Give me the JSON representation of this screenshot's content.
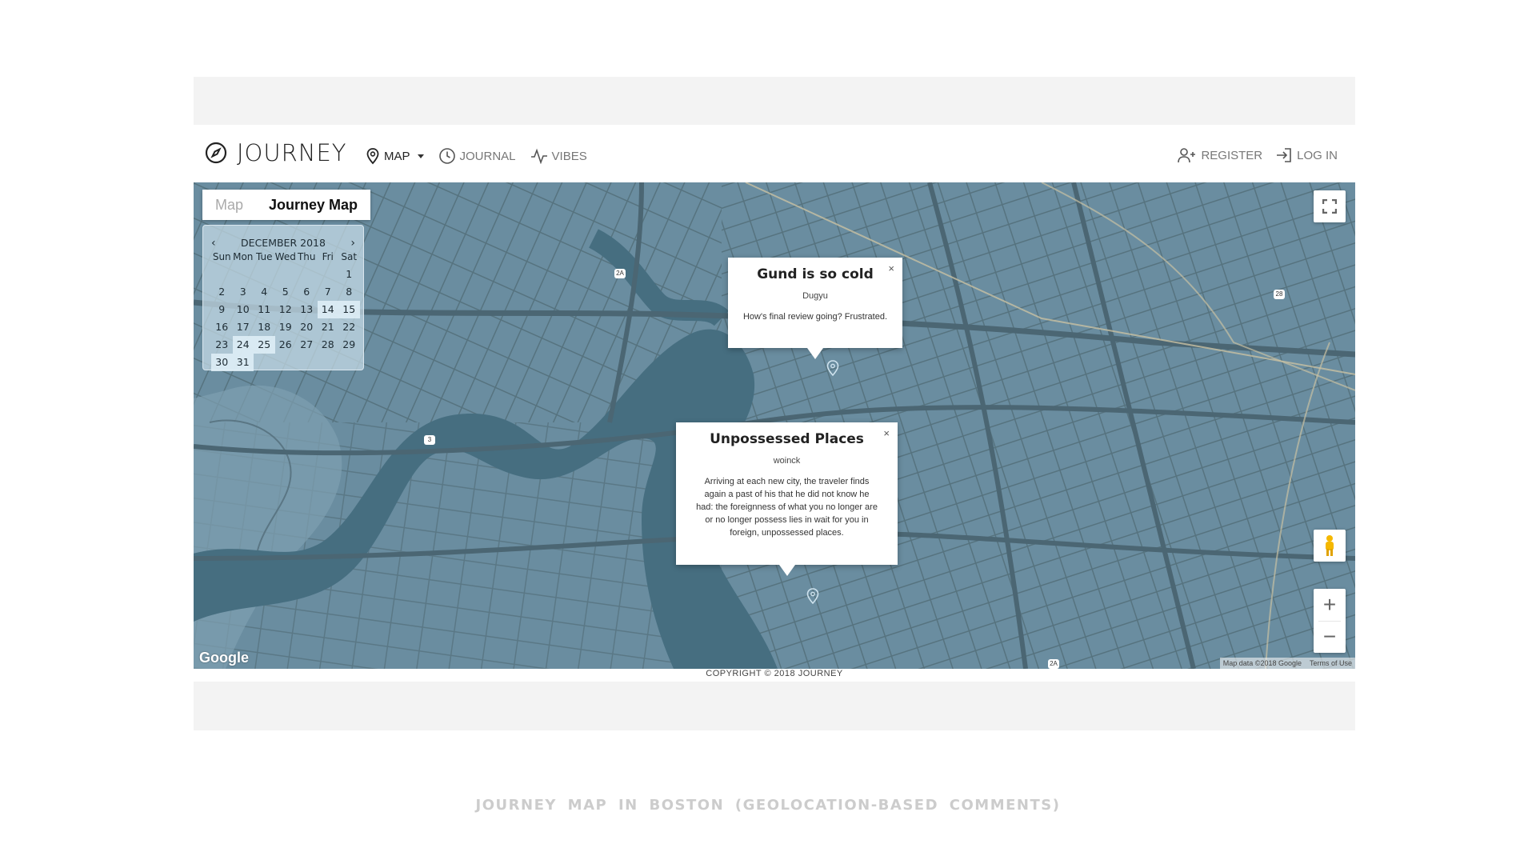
{
  "brand": {
    "name": "JOURNEY"
  },
  "nav": {
    "map": "MAP",
    "journal": "JOURNAL",
    "vibes": "VIBES",
    "register": "REGISTER",
    "login": "LOG IN"
  },
  "map_type_control": {
    "map": "Map",
    "journey_map": "Journey Map",
    "selected": "Journey Map"
  },
  "calendar": {
    "month_label": "DECEMBER 2018",
    "prev": "‹",
    "next": "›",
    "weekdays": [
      "Sun",
      "Mon",
      "Tue",
      "Wed",
      "Thu",
      "Fri",
      "Sat"
    ],
    "weeks": [
      [
        "",
        "",
        "",
        "",
        "",
        "",
        "1"
      ],
      [
        "2",
        "3",
        "4",
        "5",
        "6",
        "7",
        "8"
      ],
      [
        "9",
        "10",
        "11",
        "12",
        "13",
        "14",
        "15"
      ],
      [
        "16",
        "17",
        "18",
        "19",
        "20",
        "21",
        "22"
      ],
      [
        "23",
        "24",
        "25",
        "26",
        "27",
        "28",
        "29"
      ],
      [
        "30",
        "31",
        "",
        "",
        "",
        "",
        ""
      ]
    ],
    "highlighted": [
      "14",
      "15",
      "24",
      "25",
      "30",
      "31"
    ]
  },
  "info_windows": [
    {
      "title": "Gund is so cold",
      "author": "Dugyu",
      "body": "How's final review going? Frustrated.",
      "close": "×"
    },
    {
      "title": "Unpossessed Places",
      "author": "woinck",
      "body": "Arriving at each new city, the traveler finds again a past of his that he did not know he had: the foreignness of what you no longer are or no longer possess lies in wait for you in foreign, unpossessed places.",
      "close": "×"
    }
  ],
  "route_shields": [
    "2A",
    "28",
    "3",
    "2A"
  ],
  "map_controls": {
    "zoom_in": "+",
    "zoom_out": "−"
  },
  "google_logo": "Google",
  "attribution": {
    "map_data": "Map data ©2018 Google",
    "terms": "Terms of Use"
  },
  "footer": {
    "copyright": "COPYRIGHT © 2018 JOURNEY"
  },
  "caption": "JOURNEY MAP IN BOSTON (GEOLOCATION-BASED COMMENTS)",
  "colors": {
    "map_water": "#466e80",
    "map_land": "#6a8da0",
    "map_roads": "#4b6673",
    "band": "#f3f3f3"
  }
}
